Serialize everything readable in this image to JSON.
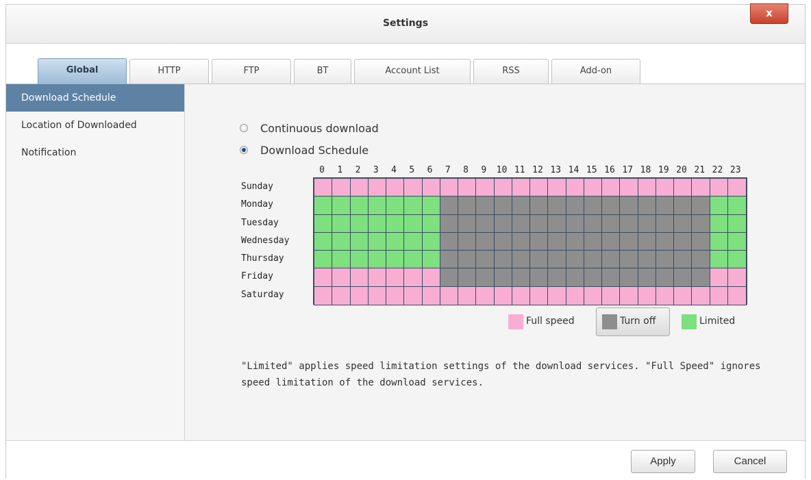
{
  "window": {
    "title": "Settings",
    "close_glyph": "x"
  },
  "tabs": [
    {
      "label": "Global",
      "active": true
    },
    {
      "label": "HTTP"
    },
    {
      "label": "FTP"
    },
    {
      "label": "BT"
    },
    {
      "label": "Account List"
    },
    {
      "label": "RSS"
    },
    {
      "label": "Add-on"
    }
  ],
  "sidebar": {
    "items": [
      {
        "label": "Download Schedule",
        "active": true
      },
      {
        "label": "Location of Downloaded"
      },
      {
        "label": "Notification"
      }
    ]
  },
  "main": {
    "radio_continuous": "Continuous download",
    "radio_schedule": "Download Schedule",
    "selected_option": "Download Schedule"
  },
  "schedule": {
    "hours": [
      "0",
      "1",
      "2",
      "3",
      "4",
      "5",
      "6",
      "7",
      "8",
      "9",
      "10",
      "11",
      "12",
      "13",
      "14",
      "15",
      "16",
      "17",
      "18",
      "19",
      "20",
      "21",
      "22",
      "23"
    ],
    "days": [
      "Sunday",
      "Monday",
      "Tuesday",
      "Wednesday",
      "Thursday",
      "Friday",
      "Saturday"
    ],
    "rows": [
      "FFFFFFFFFFFFFFFFFFFFFFFF",
      "LLLLLLLOOOOOOOOOOOOOOOLL",
      "LLLLLLLOOOOOOOOOOOOOOOLL",
      "LLLLLLLOOOOOOOOOOOOOOOLL",
      "LLLLLLLOOOOOOOOOOOOOOOLL",
      "FFFFFFFOOOOOOOOOOOOOOOFF",
      "FFFFFFFFFFFFFFFFFFFFFFFF"
    ],
    "codes": {
      "F": "full",
      "O": "off",
      "L": "limited"
    },
    "colors": {
      "full": "#f7aed2",
      "off": "#8e8e8e",
      "limited": "#7ee07e"
    }
  },
  "legend": {
    "full_speed": "Full speed",
    "turn_off": "Turn off",
    "limited": "Limited",
    "selected": "Turn off"
  },
  "note": "\"Limited\" applies speed limitation settings of the download services. \"Full Speed\" ignores speed limitation of the download services.",
  "footer": {
    "apply": "Apply",
    "cancel": "Cancel"
  }
}
